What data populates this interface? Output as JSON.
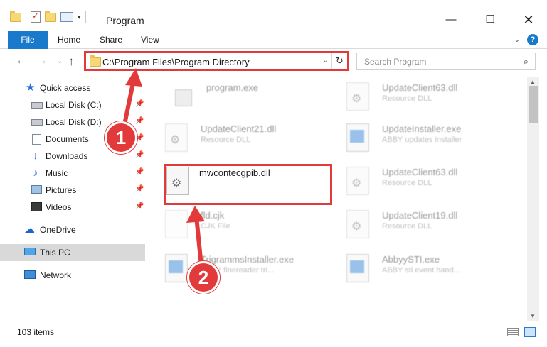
{
  "window": {
    "title": "Program",
    "minimize_symbol": "—",
    "maximize_symbol": "☐",
    "close_symbol": "✕"
  },
  "ribbon": {
    "tabs": [
      "File",
      "Home",
      "Share",
      "View"
    ],
    "collapse_symbol": "⌄",
    "help_symbol": "?"
  },
  "nav": {
    "back_symbol": "←",
    "forward_symbol": "→",
    "recent_symbol": "⌄",
    "up_symbol": "↑",
    "address": "C:\\Program Files\\Program Directory",
    "address_dropdown_symbol": "⌄",
    "refresh_symbol": "↻",
    "search_placeholder": "Search Program",
    "search_icon_symbol": "⌕"
  },
  "sidebar": {
    "items": [
      {
        "label": "Quick access",
        "pinned": false
      },
      {
        "label": "Local Disk (C:)",
        "pinned": true
      },
      {
        "label": "Local Disk (D:)",
        "pinned": true
      },
      {
        "label": "Documents",
        "pinned": true
      },
      {
        "label": "Downloads",
        "pinned": true
      },
      {
        "label": "Music",
        "pinned": true
      },
      {
        "label": "Pictures",
        "pinned": true
      },
      {
        "label": "Videos",
        "pinned": true
      },
      {
        "label": "OneDrive",
        "pinned": false
      },
      {
        "label": "This PC",
        "pinned": false,
        "selected": true
      },
      {
        "label": "Network",
        "pinned": false
      }
    ],
    "pin_symbol": "📌",
    "star_symbol": "★",
    "download_symbol": "↓",
    "music_symbol": "♪",
    "cloud_symbol": "☁"
  },
  "files": [
    {
      "name": "program.exe",
      "sub": "",
      "type": "prog",
      "focused": false
    },
    {
      "name": "UpdateClient63.dll",
      "sub": "Resource DLL",
      "type": "dll",
      "focused": false
    },
    {
      "name": "UpdateClient21.dll",
      "sub": "Resource DLL",
      "type": "dll",
      "focused": false
    },
    {
      "name": "UpdateInstaller.exe",
      "sub": "ABBY updates installer",
      "type": "exe",
      "focused": false
    },
    {
      "name": "mwcontecgpib.dll",
      "sub": "",
      "type": "dll",
      "focused": true
    },
    {
      "name": "UpdateClient63.dll",
      "sub": "Resource DLL",
      "type": "dll",
      "focused": false
    },
    {
      "name": "fld.cjk",
      "sub": "CJK File",
      "type": "doc",
      "focused": false
    },
    {
      "name": "UpdateClient19.dll",
      "sub": "Resource DLL",
      "type": "dll",
      "focused": false
    },
    {
      "name": "TrigrammsInstaller.exe",
      "sub": "ABBY finereader tri...",
      "type": "exe",
      "focused": false
    },
    {
      "name": "AbbyySTI.exe",
      "sub": "ABBY sti event hand...",
      "type": "exe",
      "focused": false
    }
  ],
  "scrollbar": {
    "up_symbol": "▲",
    "down_symbol": "▼"
  },
  "status": {
    "item_count": "103 items"
  },
  "annotations": {
    "step1": "1",
    "step2": "2",
    "color": "#e23a3a"
  }
}
